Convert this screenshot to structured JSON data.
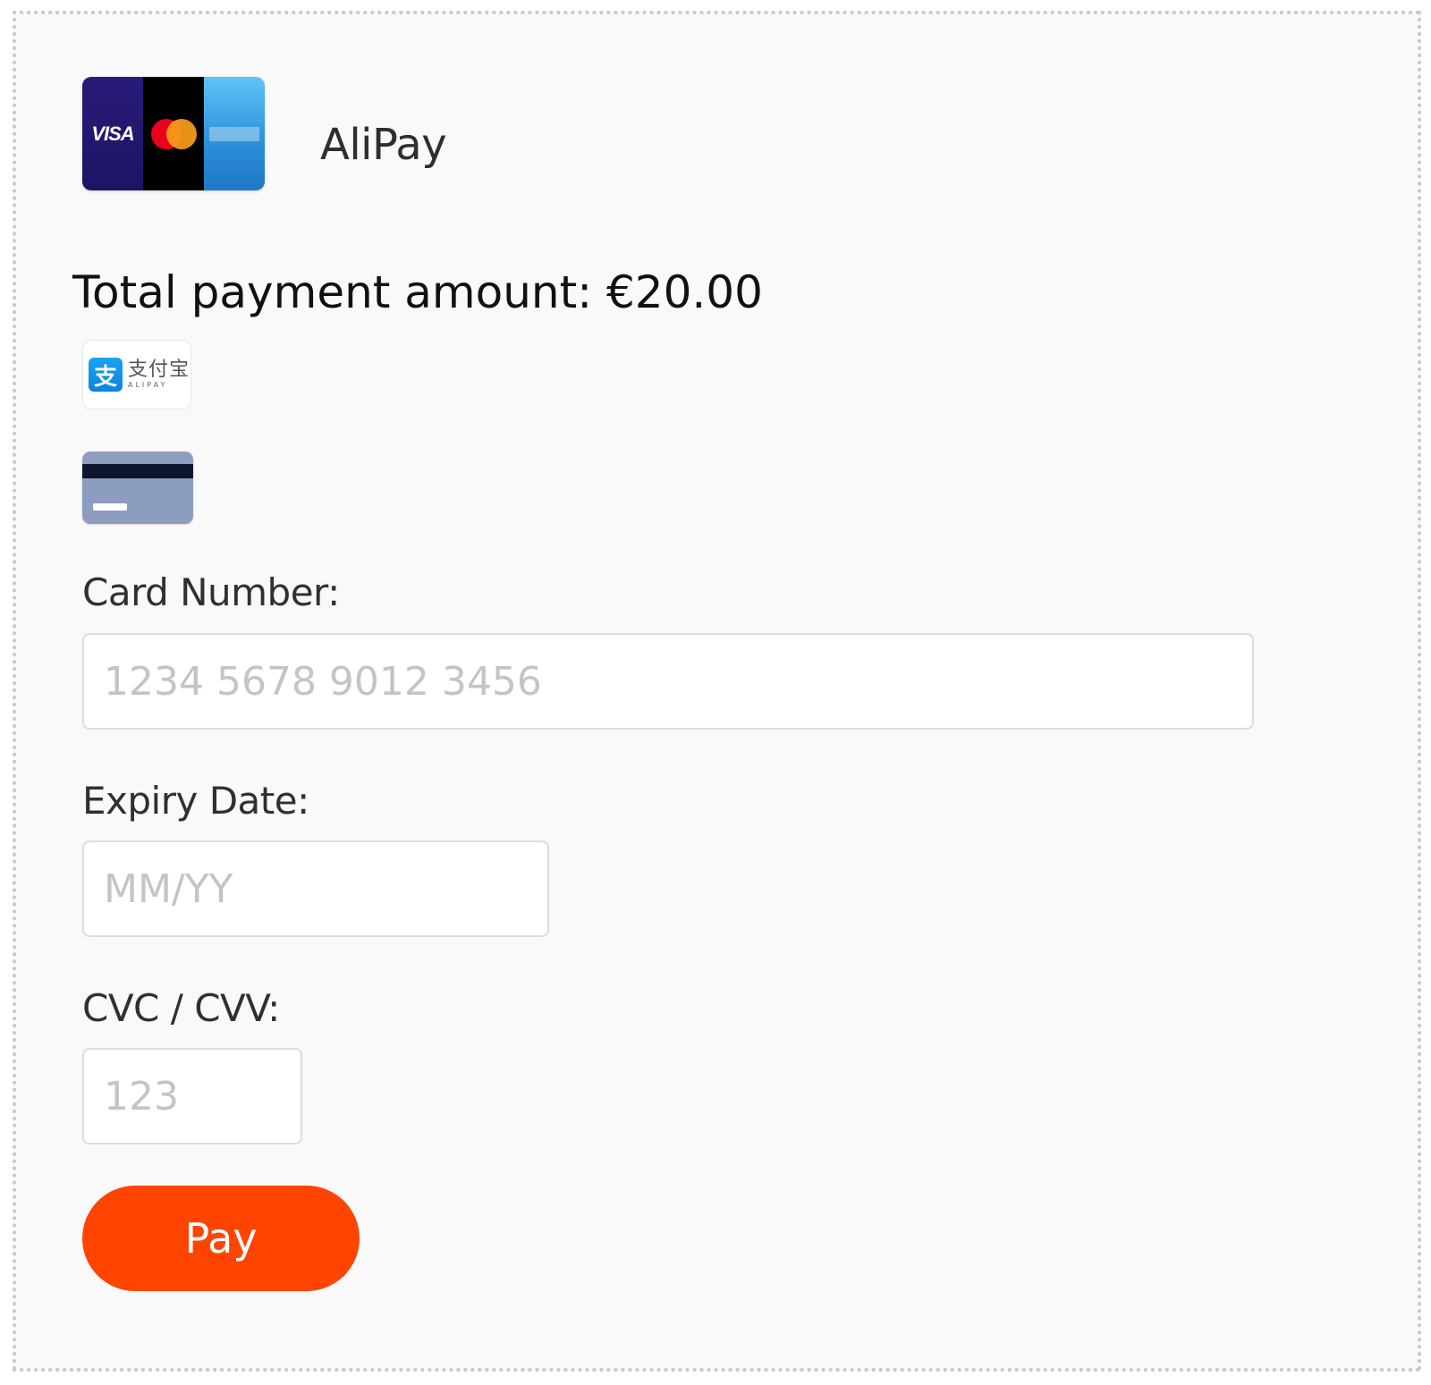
{
  "header": {
    "card_logos": {
      "visa_text": "VISA",
      "brands": [
        "visa",
        "mastercard",
        "american-express"
      ]
    },
    "title": "AliPay"
  },
  "summary": {
    "total_label": "Total payment amount: €20.00"
  },
  "payment_methods": {
    "alipay": {
      "icon": "alipay-logo",
      "mark_glyph": "支",
      "zh_text": "支付宝",
      "en_text": "ALIPAY"
    },
    "card": {
      "icon": "credit-card-icon"
    }
  },
  "form": {
    "card_number": {
      "label": "Card Number:",
      "placeholder": "1234 5678 9012 3456",
      "value": ""
    },
    "expiry": {
      "label": "Expiry Date:",
      "placeholder": "MM/YY",
      "value": ""
    },
    "cvc": {
      "label": "CVC / CVV:",
      "placeholder": "123",
      "value": ""
    },
    "submit_label": "Pay"
  },
  "colors": {
    "accent": "#ff4400",
    "background": "#f9f9f9",
    "visa_blue": "#1b1464",
    "mc_red": "#eb001b",
    "mc_orange": "#f79e1b",
    "amex_blue": "#2b8fd9",
    "alipay_blue": "#1aa2f0"
  }
}
